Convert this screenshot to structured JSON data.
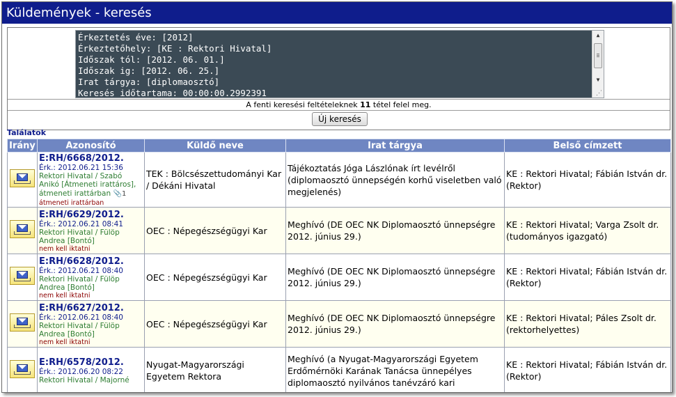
{
  "window": {
    "title": "Küldemények - keresés"
  },
  "criteria": {
    "lines": [
      "Érkeztetés éve: [2012]",
      "Érkeztetőhely: [KE : Rektori Hivatal]",
      "Időszak tól: [2012. 06. 01.]",
      "Időszak ig: [2012. 06. 25.]",
      "Irat tárgya: [diplomaosztó]",
      "Keresés időtartama: 00:00:00.2992391"
    ]
  },
  "result": {
    "prefix": "A fenti keresési feltételeknek ",
    "count": "11",
    "suffix": " tétel felel meg."
  },
  "new_search_label": "Új keresés",
  "results_label": "Találatok",
  "columns": [
    "Irány",
    "Azonosító",
    "Küldő neve",
    "Irat tárgya",
    "Belső címzett"
  ],
  "rows": [
    {
      "id": "E:RH/6668/2012.",
      "erk": "Érk.: 2012.06.21 15:36",
      "handler": "Rektori Hivatal / Szabó Anikó [Átmeneti irattáros],",
      "status": "átmeneti irattárban",
      "attachments": "1",
      "note": "átmeneti irattárban",
      "sender": "TEK : Bölcsészettudományi Kar / Dékáni Hivatal",
      "subject": "Tájékoztatás Jóga Lászlónak írt levélről (diplomaosztó ünnepségén korhű viseletben való megjelenés)",
      "recipient": "KE : Rektori Hivatal; Fábián István dr. (Rektor)"
    },
    {
      "id": "E:RH/6629/2012.",
      "erk": "Érk.: 2012.06.21 08:41",
      "handler": "Rektori Hivatal / Fülöp Andrea [Bontó]",
      "status": "",
      "attachments": "",
      "note": "nem kell iktatni",
      "sender": "OEC : Népegészségügyi Kar",
      "subject": "Meghívó (DE OEC NK Diplomaosztó ünnepségre 2012. június 29.)",
      "recipient": "KE : Rektori Hivatal; Varga Zsolt dr. (tudományos igazgató)"
    },
    {
      "id": "E:RH/6628/2012.",
      "erk": "Érk.: 2012.06.21 08:40",
      "handler": "Rektori Hivatal / Fülöp Andrea [Bontó]",
      "status": "",
      "attachments": "",
      "note": "nem kell iktatni",
      "sender": "OEC : Népegészségügyi Kar",
      "subject": "Meghívó (DE OEC NK Diplomaosztó ünnepségre 2012. június 29.)",
      "recipient": "KE : Rektori Hivatal; Fábián István dr. (Rektor)"
    },
    {
      "id": "E:RH/6627/2012.",
      "erk": "Érk.: 2012.06.21 08:40",
      "handler": "Rektori Hivatal / Fülöp Andrea [Bontó]",
      "status": "",
      "attachments": "",
      "note": "nem kell iktatni",
      "sender": "OEC : Népegészségügyi Kar",
      "subject": "Meghívó (DE OEC NK Diplomaosztó ünnepségre 2012. június 29.)",
      "recipient": "KE : Rektori Hivatal; Páles Zsolt dr. (rektorhelyettes)"
    },
    {
      "id": "E:RH/6578/2012.",
      "erk": "Érk.: 2012.06.20 08:22",
      "handler": "Rektori Hivatal / Majorné",
      "status": "",
      "attachments": "",
      "note": "",
      "sender": "Nyugat-Magyarországi Egyetem Rektora",
      "subject": "Meghívó (a Nyugat-Magyarországi Egyetem Erdőmérnöki Karának Tanácsa ünnepélyes diplomaosztó nyilvános tanévzáró kari",
      "recipient": "KE : Rektori Hivatal; Fábián István dr. (Rektor)"
    }
  ]
}
